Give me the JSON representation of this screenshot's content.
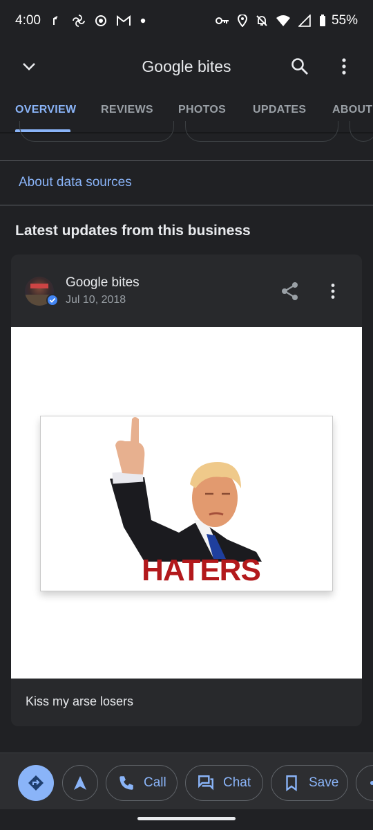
{
  "status_bar": {
    "time": "4:00",
    "battery": "55%"
  },
  "app_bar": {
    "title": "Google bites"
  },
  "tabs": [
    {
      "label": "OVERVIEW",
      "active": true
    },
    {
      "label": "REVIEWS",
      "active": false
    },
    {
      "label": "PHOTOS",
      "active": false
    },
    {
      "label": "UPDATES",
      "active": false
    },
    {
      "label": "ABOUT",
      "active": false
    }
  ],
  "about_data_sources": "About data sources",
  "section": {
    "title": "Latest updates from this business"
  },
  "post": {
    "business_name": "Google bites",
    "date": "Jul 10, 2018",
    "image_text": "HATERS",
    "caption": "Kiss my arse losers"
  },
  "actions": [
    {
      "label": "Call",
      "icon": "phone-icon"
    },
    {
      "label": "Chat",
      "icon": "chat-icon"
    },
    {
      "label": "Save",
      "icon": "bookmark-icon"
    }
  ],
  "colors": {
    "accent": "#8ab4f8",
    "background": "#202124",
    "card": "#28292c",
    "haters_red": "#b3191c"
  }
}
